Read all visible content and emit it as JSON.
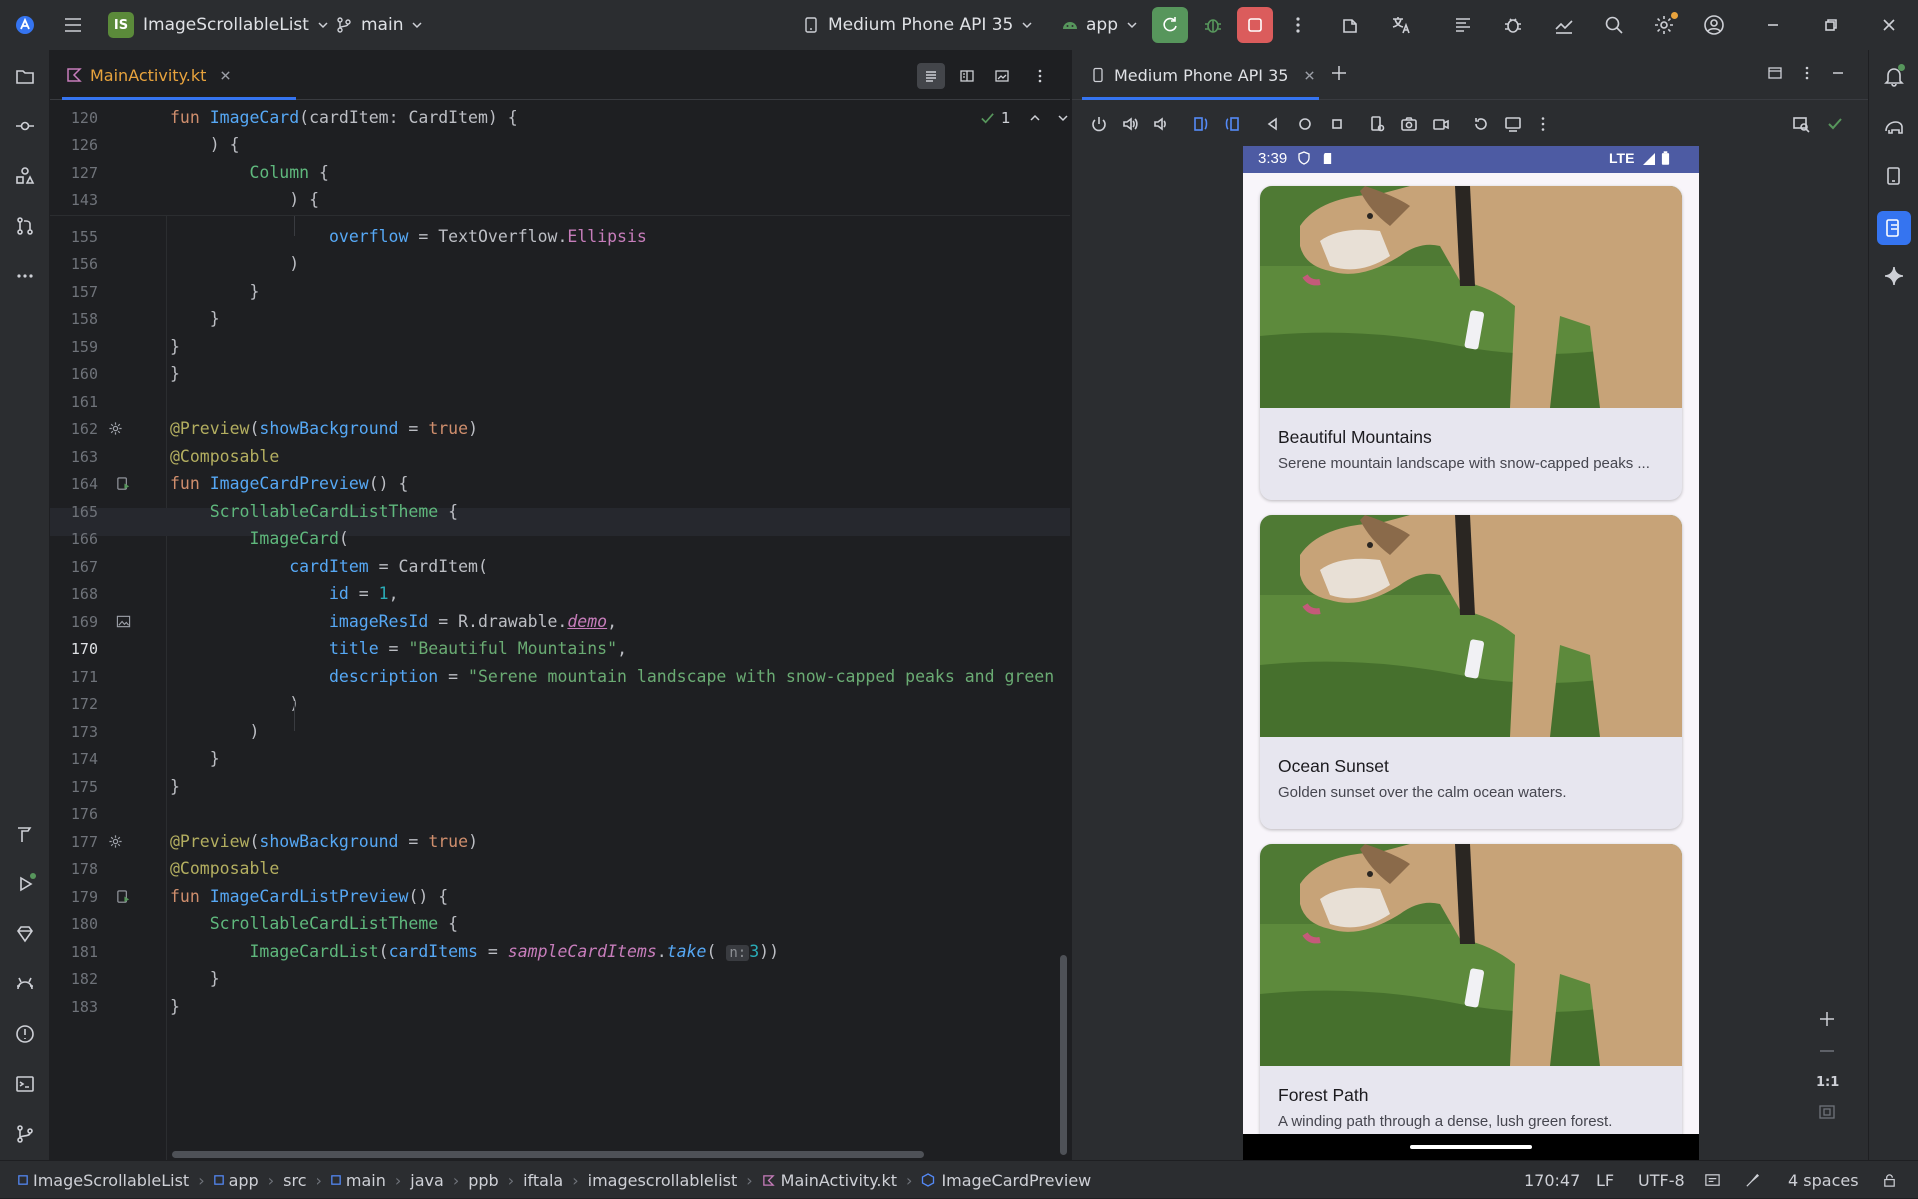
{
  "titlebar": {
    "project_badge": "IS",
    "project_name": "ImageScrollableList",
    "branch": "main",
    "device": "Medium Phone API 35",
    "run_config": "app"
  },
  "editor": {
    "tab_label": "MainActivity.kt",
    "inspection_count": "1",
    "sticky_lines": [
      {
        "num": "120",
        "html": "fun ImageCard(cardItem: CardItem) {"
      },
      {
        "num": "126",
        "html": "    ) {"
      },
      {
        "num": "127",
        "html": "        Column {"
      },
      {
        "num": "143",
        "html": "            ) {"
      }
    ],
    "lines": [
      {
        "num": "155",
        "text": "                overflow = TextOverflow.Ellipsis"
      },
      {
        "num": "156",
        "text": "            )"
      },
      {
        "num": "157",
        "text": "        }"
      },
      {
        "num": "158",
        "text": "    }"
      },
      {
        "num": "159",
        "text": "}"
      },
      {
        "num": "160",
        "text": "}"
      },
      {
        "num": "161",
        "text": ""
      },
      {
        "num": "162",
        "text": "@Preview(showBackground = true)"
      },
      {
        "num": "163",
        "text": "@Composable"
      },
      {
        "num": "164",
        "text": "fun ImageCardPreview() {"
      },
      {
        "num": "165",
        "text": "    ScrollableCardListTheme {"
      },
      {
        "num": "166",
        "text": "        ImageCard("
      },
      {
        "num": "167",
        "text": "            cardItem = CardItem("
      },
      {
        "num": "168",
        "text": "                id = 1,"
      },
      {
        "num": "169",
        "text": "                imageResId = R.drawable.demo,"
      },
      {
        "num": "170",
        "text": "                title = \"Beautiful Mountains\","
      },
      {
        "num": "171",
        "text": "                description = \"Serene mountain landscape with snow-capped peaks and green"
      },
      {
        "num": "172",
        "text": "            )"
      },
      {
        "num": "173",
        "text": "        )"
      },
      {
        "num": "174",
        "text": "    }"
      },
      {
        "num": "175",
        "text": "}"
      },
      {
        "num": "176",
        "text": ""
      },
      {
        "num": "177",
        "text": "@Preview(showBackground = true)"
      },
      {
        "num": "178",
        "text": "@Composable"
      },
      {
        "num": "179",
        "text": "fun ImageCardListPreview() {"
      },
      {
        "num": "180",
        "text": "    ScrollableCardListTheme {"
      },
      {
        "num": "181",
        "text": "        ImageCardList(cardItems = sampleCardItems.take( n: 3))"
      },
      {
        "num": "182",
        "text": "    }"
      },
      {
        "num": "183",
        "text": "}"
      }
    ],
    "inlay_hint": "n:"
  },
  "emulator": {
    "tab_label": "Medium Phone API 35",
    "status_time": "3:39",
    "status_network": "LTE",
    "cards": [
      {
        "title": "Beautiful Mountains",
        "description": "Serene mountain landscape with snow-capped peaks ..."
      },
      {
        "title": "Ocean Sunset",
        "description": "Golden sunset over the calm ocean waters."
      },
      {
        "title": "Forest Path",
        "description": "A winding path through a dense, lush green forest."
      }
    ],
    "zoom_label": "1:1"
  },
  "statusbar": {
    "breadcrumbs": [
      "ImageScrollableList",
      "app",
      "src",
      "main",
      "java",
      "ppb",
      "iftala",
      "imagescrollablelist",
      "MainActivity.kt",
      "ImageCardPreview"
    ],
    "position": "170:47",
    "line_ending": "LF",
    "encoding": "UTF-8",
    "indent": "4 spaces"
  },
  "colors": {
    "accent": "#3574f0",
    "run_green": "#57965c",
    "stop_red": "#db5c5c",
    "phone_status": "#4d5ba3"
  }
}
